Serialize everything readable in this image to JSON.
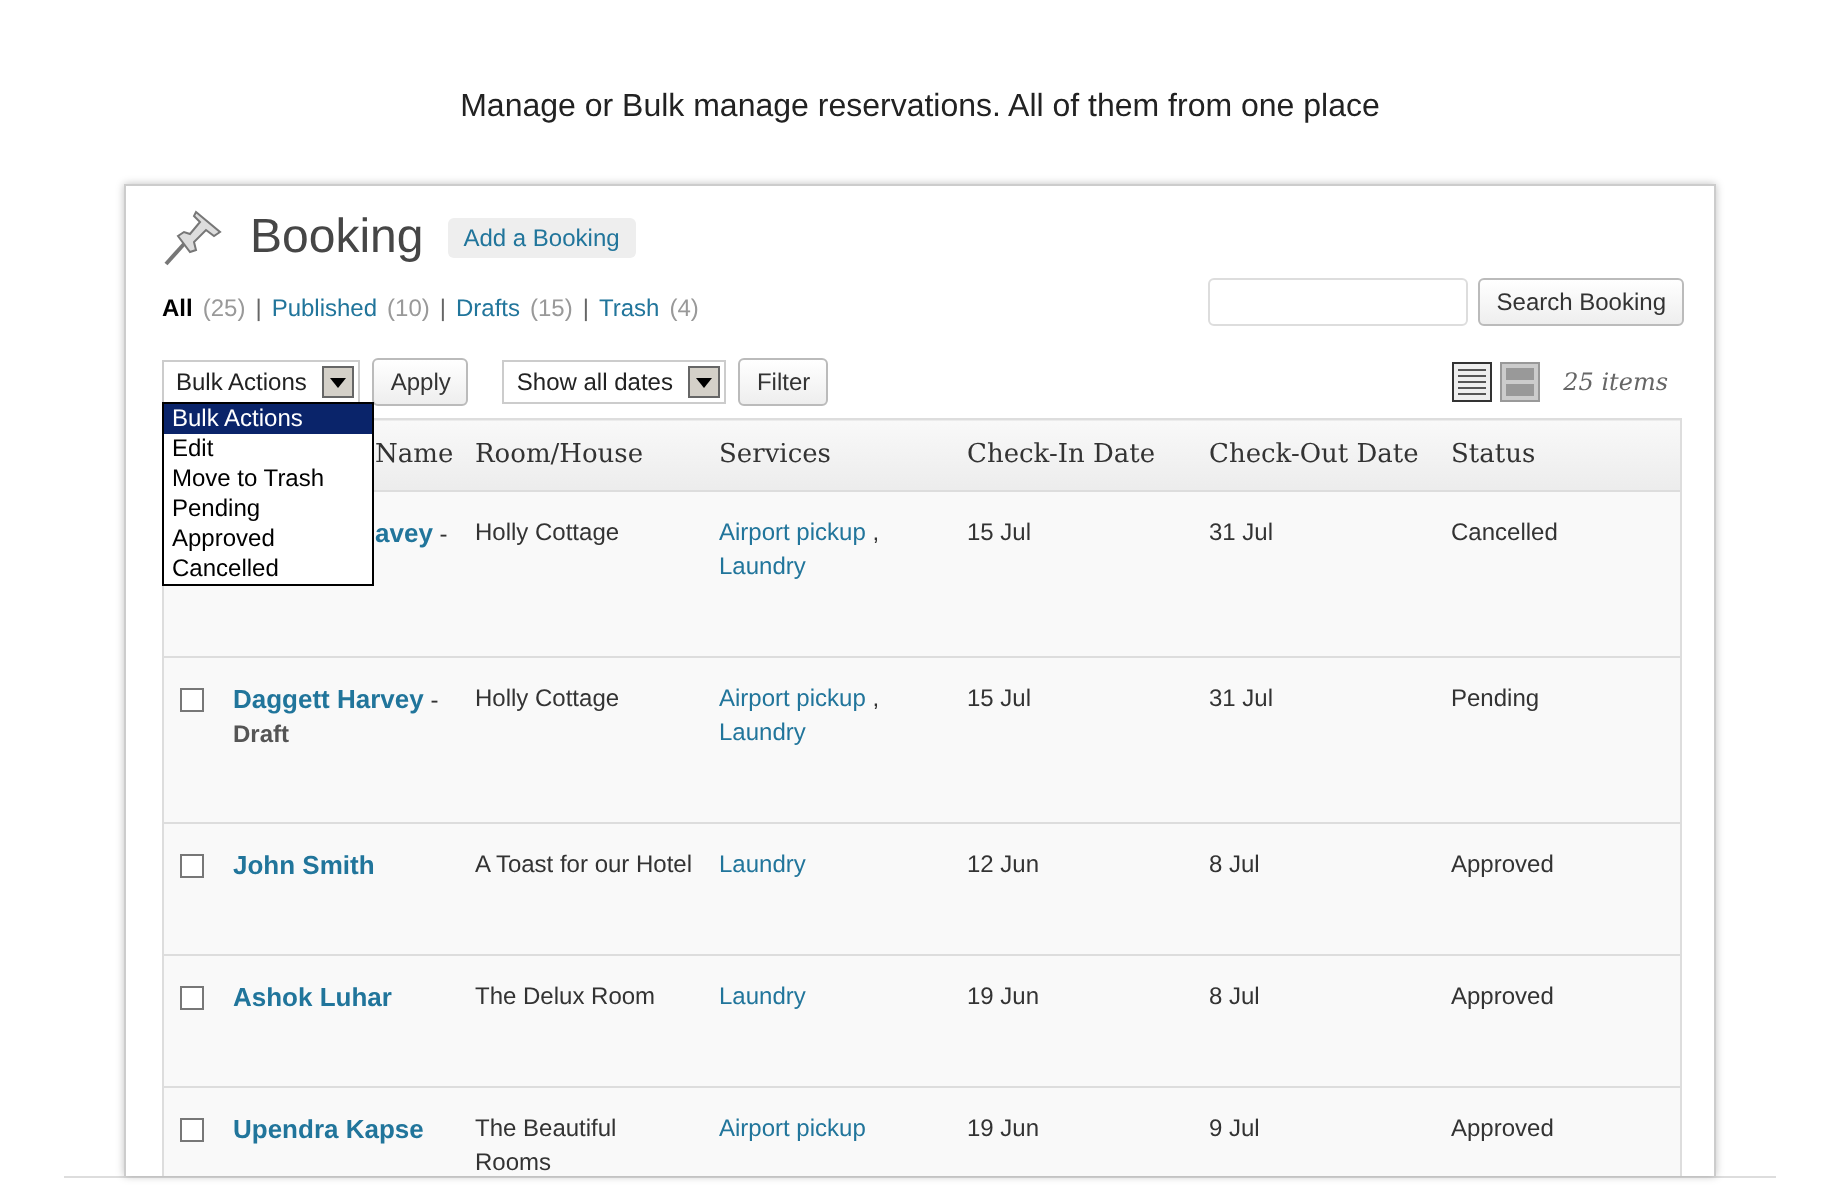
{
  "caption": "Manage or Bulk manage reservations. All of them from one place",
  "page": {
    "title": "Booking",
    "add_button": "Add a Booking"
  },
  "views": [
    {
      "label": "All",
      "count": "(25)",
      "selected": true
    },
    {
      "label": "Published",
      "count": "(10)",
      "selected": false
    },
    {
      "label": "Drafts",
      "count": "(15)",
      "selected": false
    },
    {
      "label": "Trash",
      "count": "(4)",
      "selected": false
    }
  ],
  "view_separator": "|",
  "search": {
    "button": "Search Booking"
  },
  "bulk_actions": {
    "value": "Bulk Actions",
    "expanded": true,
    "apply": "Apply",
    "options": [
      {
        "label": "Bulk Actions",
        "selected": true
      },
      {
        "label": "Edit",
        "selected": false
      },
      {
        "label": "Move to Trash",
        "selected": false
      },
      {
        "label": "Pending",
        "selected": false
      },
      {
        "label": "Approved",
        "selected": false
      },
      {
        "label": "Cancelled",
        "selected": false
      }
    ]
  },
  "date_filter": {
    "value": "Show all dates",
    "button": "Filter"
  },
  "view_modes": [
    {
      "kind": "list",
      "selected": true
    },
    {
      "kind": "excerpt",
      "selected": false
    }
  ],
  "item_count": "25 items",
  "table": {
    "columns": [
      {
        "label": "Name"
      },
      {
        "label": "Room/House"
      },
      {
        "label": "Services"
      },
      {
        "label": "Check-In Date"
      },
      {
        "label": "Check-Out Date"
      },
      {
        "label": "Status"
      }
    ],
    "service_separator": ",",
    "rows": [
      {
        "name": "avey",
        "name_suffix": "-",
        "room": "Holly Cottage",
        "services": [
          "Airport pickup",
          "Laundry"
        ],
        "check_in": "15 Jul",
        "check_out": "31 Jul",
        "status": "Cancelled"
      },
      {
        "name": "Daggett Harvey",
        "name_suffix": "-",
        "draft": "Draft",
        "room": "Holly Cottage",
        "services": [
          "Airport pickup",
          "Laundry"
        ],
        "check_in": "15 Jul",
        "check_out": "31 Jul",
        "status": "Pending",
        "checked": false
      },
      {
        "name": "John Smith",
        "room": "A Toast for our Hotel",
        "services": [
          "Laundry"
        ],
        "check_in": "12 Jun",
        "check_out": "8 Jul",
        "status": "Approved",
        "checked": false
      },
      {
        "name": "Ashok Luhar",
        "room": "The Delux Room",
        "services": [
          "Laundry"
        ],
        "check_in": "19 Jun",
        "check_out": "8 Jul",
        "status": "Approved",
        "checked": false
      },
      {
        "name": "Upendra Kapse",
        "room": "The Beautiful Rooms",
        "services": [
          "Airport pickup"
        ],
        "check_in": "19 Jun",
        "check_out": "9 Jul",
        "status": "Approved",
        "checked": false
      }
    ]
  }
}
